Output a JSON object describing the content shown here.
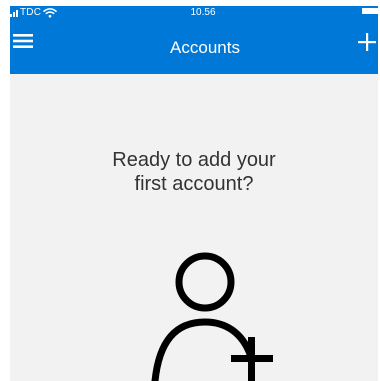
{
  "status_bar": {
    "carrier": "TDC",
    "time": "10.56"
  },
  "header": {
    "title": "Accounts"
  },
  "empty_state": {
    "line1": "Ready to add your",
    "line2": "first account?",
    "icon": "person-add-icon"
  },
  "icons": {
    "menu": "hamburger-icon",
    "add": "plus-icon",
    "wifi": "wifi-icon"
  },
  "colors": {
    "accent": "#0078d7",
    "background": "#f2f2f2",
    "text": "#333333",
    "header_text": "#ffffff"
  }
}
